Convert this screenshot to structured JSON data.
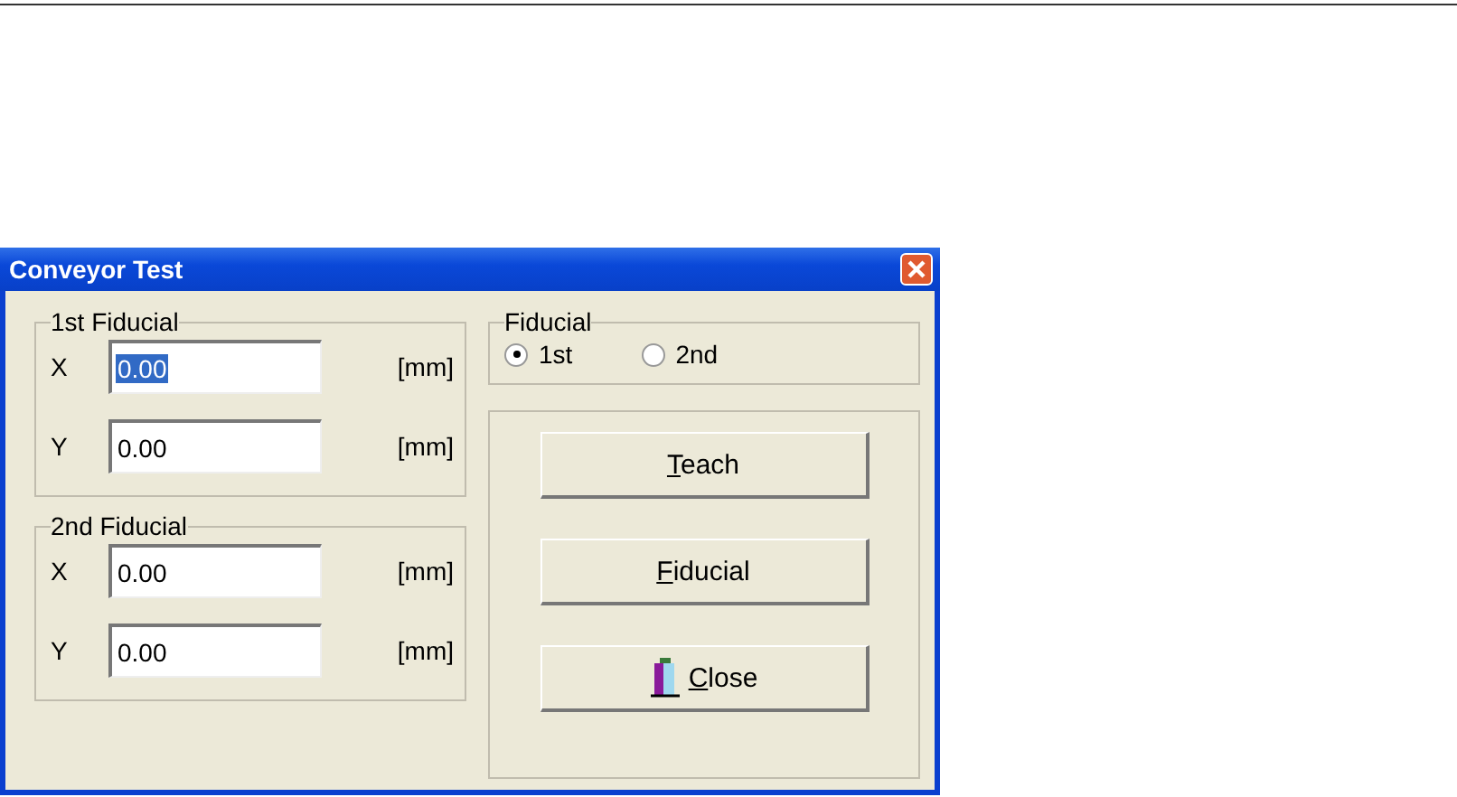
{
  "window": {
    "title": "Conveyor Test"
  },
  "groups": [
    {
      "title": "1st Fiducial",
      "fields": [
        {
          "label": "X",
          "value": "0.00",
          "text_selected": true,
          "unit": "[mm]"
        },
        {
          "label": "Y",
          "value": "0.00",
          "text_selected": false,
          "unit": "[mm]"
        }
      ]
    },
    {
      "title": "2nd Fiducial",
      "fields": [
        {
          "label": "X",
          "value": "0.00",
          "text_selected": false,
          "unit": "[mm]"
        },
        {
          "label": "Y",
          "value": "0.00",
          "text_selected": false,
          "unit": "[mm]"
        }
      ]
    }
  ],
  "fiducial": {
    "title": "Fiducial",
    "options": [
      {
        "label": "1st",
        "selected": true
      },
      {
        "label": "2nd",
        "selected": false
      }
    ]
  },
  "buttons": [
    {
      "label": "Teach",
      "kind": "plain"
    },
    {
      "label": "Fiducial",
      "kind": "plain"
    },
    {
      "label": "Close",
      "kind": "close"
    }
  ]
}
